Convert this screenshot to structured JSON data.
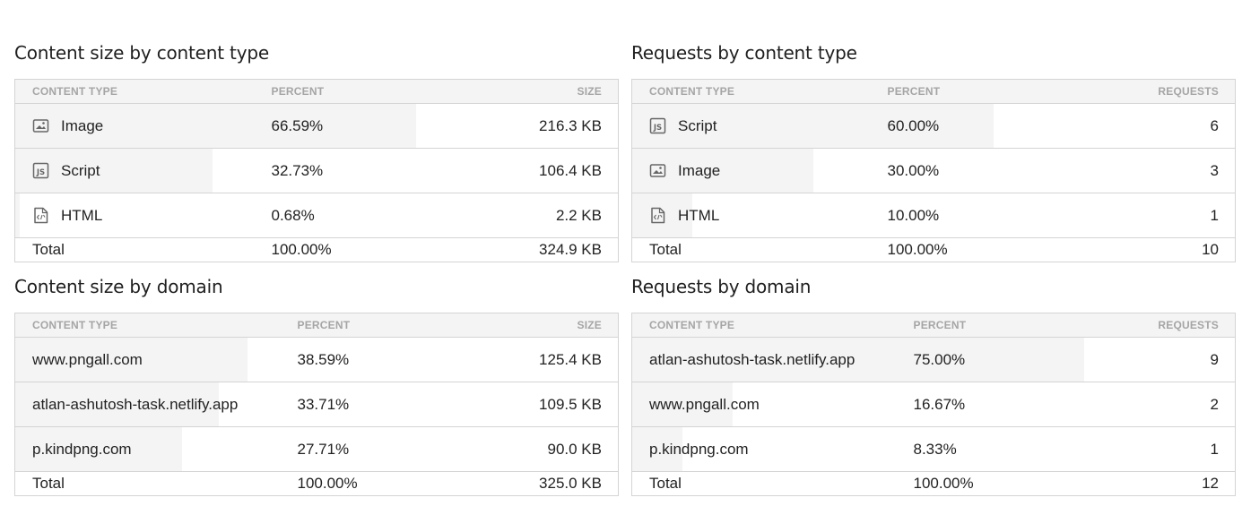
{
  "panels": {
    "size_type": {
      "title": "Content size by content type",
      "headers": [
        "CONTENT TYPE",
        "PERCENT",
        "SIZE"
      ],
      "rows": [
        {
          "label": "Image",
          "icon": "image-icon",
          "percent": "66.59%",
          "value": "216.3 KB",
          "fraction": 0.6659
        },
        {
          "label": "Script",
          "icon": "js-icon",
          "percent": "32.73%",
          "value": "106.4 KB",
          "fraction": 0.3273
        },
        {
          "label": "HTML",
          "icon": "html-icon",
          "percent": "0.68%",
          "value": "2.2 KB",
          "fraction": 0.0068
        }
      ],
      "total": {
        "label": "Total",
        "percent": "100.00%",
        "value": "324.9 KB"
      }
    },
    "requests_type": {
      "title": "Requests by content type",
      "headers": [
        "CONTENT TYPE",
        "PERCENT",
        "REQUESTS"
      ],
      "rows": [
        {
          "label": "Script",
          "icon": "js-icon",
          "percent": "60.00%",
          "value": "6",
          "fraction": 0.6
        },
        {
          "label": "Image",
          "icon": "image-icon",
          "percent": "30.00%",
          "value": "3",
          "fraction": 0.3
        },
        {
          "label": "HTML",
          "icon": "html-icon",
          "percent": "10.00%",
          "value": "1",
          "fraction": 0.1
        }
      ],
      "total": {
        "label": "Total",
        "percent": "100.00%",
        "value": "10"
      }
    },
    "size_domain": {
      "title": "Content size by domain",
      "headers": [
        "CONTENT TYPE",
        "PERCENT",
        "SIZE"
      ],
      "rows": [
        {
          "label": "www.pngall.com",
          "percent": "38.59%",
          "value": "125.4 KB",
          "fraction": 0.3859
        },
        {
          "label": "atlan-ashutosh-task.netlify.app",
          "percent": "33.71%",
          "value": "109.5 KB",
          "fraction": 0.3371
        },
        {
          "label": "p.kindpng.com",
          "percent": "27.71%",
          "value": "90.0 KB",
          "fraction": 0.2771
        }
      ],
      "total": {
        "label": "Total",
        "percent": "100.00%",
        "value": "325.0 KB"
      }
    },
    "requests_domain": {
      "title": "Requests by domain",
      "headers": [
        "CONTENT TYPE",
        "PERCENT",
        "REQUESTS"
      ],
      "rows": [
        {
          "label": "atlan-ashutosh-task.netlify.app",
          "percent": "75.00%",
          "value": "9",
          "fraction": 0.75
        },
        {
          "label": "www.pngall.com",
          "percent": "16.67%",
          "value": "2",
          "fraction": 0.1667
        },
        {
          "label": "p.kindpng.com",
          "percent": "8.33%",
          "value": "1",
          "fraction": 0.0833
        }
      ],
      "total": {
        "label": "Total",
        "percent": "100.00%",
        "value": "12"
      }
    }
  },
  "colors": {
    "bar_fill": "#f4f4f4",
    "border": "#d4d4d4",
    "header_text": "#a5a5a5"
  }
}
